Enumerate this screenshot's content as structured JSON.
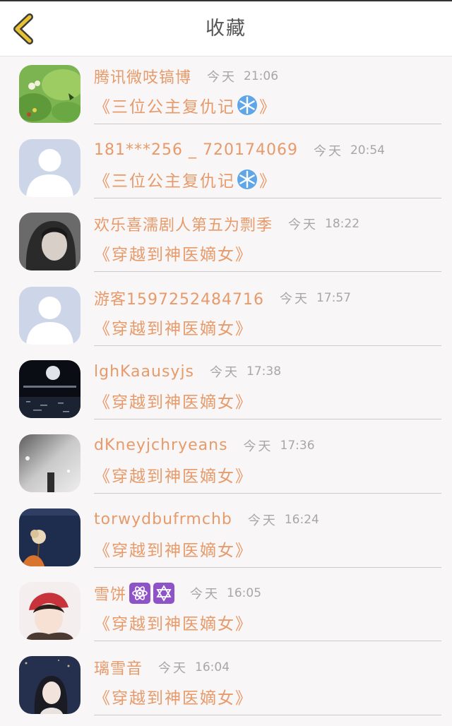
{
  "header": {
    "title": "收藏",
    "back_icon": "chevron-left-icon",
    "accent": "#e8c235"
  },
  "colors": {
    "name": "#e79a6a",
    "meta": "#a7a7a7",
    "divider": "#cfcaca"
  },
  "items": [
    {
      "name": "腾讯微吱镐博",
      "day": "今天",
      "time": "21:06",
      "book_open": "《三位公主复仇记",
      "book_close": "》",
      "avatar": "green-leaf-avatar",
      "emoji": "snowflake-icon"
    },
    {
      "name": "181***256 _ 720174069",
      "day": "今天",
      "time": "20:54",
      "book_open": "《三位公主复仇记",
      "book_close": "》",
      "avatar": "default-avatar",
      "emoji": "snowflake-icon"
    },
    {
      "name": "欢乐喜濡剧人第五为剽季",
      "day": "今天",
      "time": "18:22",
      "book": "《穿越到神医嫡女》",
      "avatar": "hooded-person-avatar"
    },
    {
      "name": "游客1597252484716",
      "day": "今天",
      "time": "17:57",
      "book": "《穿越到神医嫡女》",
      "avatar": "default-avatar"
    },
    {
      "name": "lghKaausyjs",
      "day": "今天",
      "time": "17:38",
      "book": "《穿越到神医嫡女》",
      "avatar": "night-moon-avatar"
    },
    {
      "name": "dKneyjchryeans",
      "day": "今天",
      "time": "17:36",
      "book": "《穿越到神医嫡女》",
      "avatar": "grey-sky-avatar"
    },
    {
      "name": "torwydbufrmchb",
      "day": "今天",
      "time": "16:24",
      "book": "《穿越到神医嫡女》",
      "avatar": "flower-avatar"
    },
    {
      "name": "雪饼",
      "day": "今天",
      "time": "16:05",
      "book": "《穿越到神医嫡女》",
      "avatar": "anime-boy-avatar",
      "emoji": [
        "atom-icon",
        "star-of-david-icon"
      ]
    },
    {
      "name": "璃雪音",
      "day": "今天",
      "time": "16:04",
      "book": "《穿越到神医嫡女》",
      "avatar": "anime-girl-avatar"
    }
  ]
}
